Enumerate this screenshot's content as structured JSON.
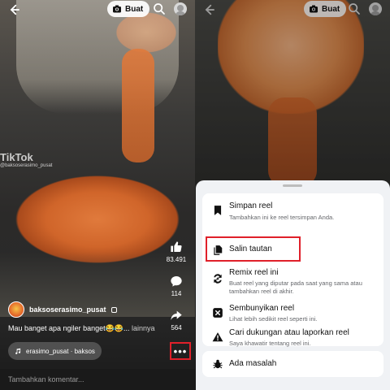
{
  "left": {
    "create_label": "Buat",
    "watermark": "TikTok",
    "watermark_user": "@baksoserasimo_pusat",
    "likes": "83.491",
    "comments": "114",
    "shares": "564",
    "author": "baksoserasimo_pusat",
    "caption": "Mau banget apa ngiler banget😂😂...",
    "caption_more": "lainnya",
    "audio": "erasimo_pusat · baksos",
    "comment_placeholder": "Tambahkan komentar..."
  },
  "right": {
    "create_label": "Buat"
  },
  "sheet": {
    "items": [
      {
        "title": "Simpan reel",
        "desc": "Tambahkan ini ke reel tersimpan Anda."
      },
      {
        "title": "Salin tautan",
        "desc": ""
      },
      {
        "title": "Remix reel ini",
        "desc": "Buat reel yang diputar pada saat yang sama atau tambahkan reel di akhir."
      },
      {
        "title": "Sembunyikan reel",
        "desc": "Lihat lebih sedikit reel seperti ini."
      },
      {
        "title": "Cari dukungan atau laporkan reel",
        "desc": "Saya khawatir tentang reel ini."
      }
    ],
    "report": "Ada masalah"
  },
  "colors": {
    "highlight": "#e0202a",
    "sheet_bg": "#f0f2f5"
  }
}
